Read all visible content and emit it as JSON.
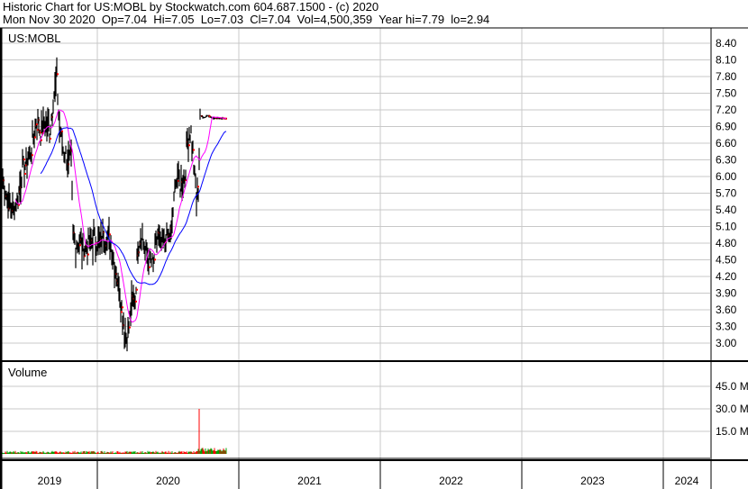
{
  "header": {
    "line1": "Historic Chart for US:MOBL by Stockwatch.com 604.687.1500 - (c) 2020",
    "line2": "Mon Nov 30 2020  Op=7.04  Hi=7.05  Lo=7.03  Cl=7.04  Vol=4,500,359  Year hi=7.79  lo=2.94"
  },
  "chart_data": {
    "type": "line",
    "symbol": "US:MOBL",
    "volume_label": "Volume",
    "price_ticks": [
      "8.40",
      "8.10",
      "7.80",
      "7.50",
      "7.20",
      "6.90",
      "6.60",
      "6.30",
      "6.00",
      "5.70",
      "5.40",
      "5.10",
      "4.80",
      "4.50",
      "4.20",
      "3.90",
      "3.60",
      "3.30",
      "3.00"
    ],
    "price_ylim": [
      3.0,
      8.4
    ],
    "volume_ticks": [
      "45.0 M",
      "30.0 M",
      "15.0 M"
    ],
    "volume_ylim": [
      0,
      45
    ],
    "x_labels": [
      "2019",
      "2020",
      "2021",
      "2022",
      "2023",
      "2024"
    ],
    "xlim": [
      2018.69,
      2024.33
    ],
    "colors": {
      "price": "#000000",
      "ma_short": "#ff00ff",
      "ma_long": "#0000ff",
      "vol_up": "#00a000",
      "vol_down": "#ff0000"
    },
    "close": [
      [
        2019.325,
        6.0
      ],
      [
        2019.363,
        5.6
      ],
      [
        2019.408,
        5.4
      ],
      [
        2019.439,
        5.6
      ],
      [
        2019.471,
        6.1
      ],
      [
        2019.503,
        6.3
      ],
      [
        2019.535,
        6.5
      ],
      [
        2019.567,
        7.0
      ],
      [
        2019.599,
        6.8
      ],
      [
        2019.631,
        7.0
      ],
      [
        2019.662,
        6.8
      ],
      [
        2019.694,
        7.5
      ],
      [
        2019.713,
        7.7
      ],
      [
        2019.732,
        6.9
      ],
      [
        2019.758,
        6.5
      ],
      [
        2019.79,
        6.3
      ],
      [
        2019.815,
        6.3
      ],
      [
        2019.828,
        4.9
      ],
      [
        2019.854,
        4.8
      ],
      [
        2019.885,
        4.8
      ],
      [
        2019.917,
        4.7
      ],
      [
        2019.949,
        4.8
      ],
      [
        2019.981,
        4.9
      ],
      [
        2020.013,
        4.8
      ],
      [
        2020.045,
        4.9
      ],
      [
        2020.076,
        4.9
      ],
      [
        2020.108,
        4.6
      ],
      [
        2020.127,
        4.3
      ],
      [
        2020.153,
        4.0
      ],
      [
        2020.172,
        3.6
      ],
      [
        2020.191,
        3.2
      ],
      [
        2020.204,
        3.1
      ],
      [
        2020.223,
        3.3
      ],
      [
        2020.242,
        3.7
      ],
      [
        2020.268,
        3.8
      ],
      [
        2020.287,
        4.8
      ],
      [
        2020.312,
        5.0
      ],
      [
        2020.331,
        4.7
      ],
      [
        2020.363,
        4.5
      ],
      [
        2020.395,
        4.4
      ],
      [
        2020.427,
        5.0
      ],
      [
        2020.446,
        4.7
      ],
      [
        2020.471,
        4.8
      ],
      [
        2020.49,
        4.9
      ],
      [
        2020.522,
        5.0
      ],
      [
        2020.541,
        5.5
      ],
      [
        2020.554,
        6.0
      ],
      [
        2020.573,
        5.9
      ],
      [
        2020.586,
        5.8
      ],
      [
        2020.618,
        6.0
      ],
      [
        2020.637,
        6.7
      ],
      [
        2020.662,
        6.8
      ],
      [
        2020.688,
        6.0
      ],
      [
        2020.701,
        5.6
      ],
      [
        2020.713,
        5.8
      ],
      [
        2020.726,
        7.1
      ],
      [
        2020.752,
        7.05
      ],
      [
        2020.777,
        7.1
      ],
      [
        2020.809,
        7.05
      ],
      [
        2020.841,
        7.05
      ],
      [
        2020.873,
        7.05
      ],
      [
        2020.914,
        7.04
      ]
    ],
    "volume_spike": [
      2020.701,
      30.0
    ]
  }
}
